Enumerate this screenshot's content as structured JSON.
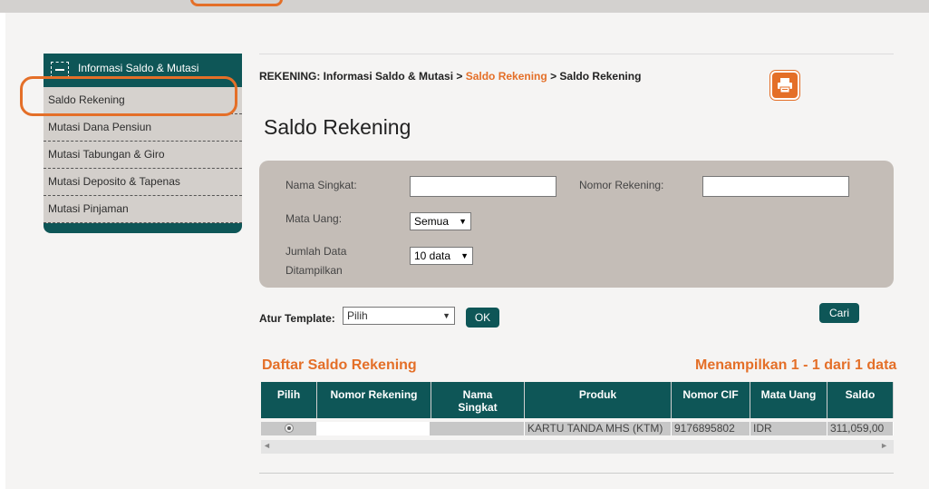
{
  "sidebar": {
    "header": "Informasi Saldo & Mutasi",
    "items": [
      "Saldo Rekening",
      "Mutasi Dana Pensiun",
      "Mutasi Tabungan & Giro",
      "Mutasi Deposito & Tapenas",
      "Mutasi Pinjaman"
    ]
  },
  "breadcrumb": {
    "part1": "REKENING: Informasi Saldo & Mutasi > ",
    "link": "Saldo Rekening",
    "part2": " > Saldo Rekening"
  },
  "page_title": "Saldo Rekening",
  "filter": {
    "nama_singkat_label": "Nama Singkat:",
    "nama_singkat_value": "",
    "nomor_rekening_label": "Nomor Rekening:",
    "nomor_rekening_value": "",
    "mata_uang_label": "Mata Uang:",
    "mata_uang_value": "Semua",
    "jumlah_label_1": "Jumlah Data",
    "jumlah_label_2": "Ditampilkan",
    "jumlah_value": "10 data"
  },
  "template": {
    "label": "Atur Template:",
    "value": "Pilih",
    "ok": "OK"
  },
  "search_button": "Cari",
  "list": {
    "title": "Daftar Saldo Rekening",
    "count": "Menampilkan 1 - 1 dari 1 data",
    "headers": [
      "Pilih",
      "Nomor Rekening",
      "Nama Singkat",
      "Produk",
      "Nomor CIF",
      "Mata Uang",
      "Saldo"
    ],
    "row": {
      "nomor_rekening": "",
      "nama_singkat": "",
      "produk": "KARTU TANDA MHS (KTM)",
      "nomor_cif": "9176895802",
      "mata_uang": "IDR",
      "saldo": "311,059,00"
    }
  },
  "icons": {
    "print": "printer-icon",
    "menu": "collapse-icon"
  },
  "colors": {
    "primary": "#0e5657",
    "accent": "#e46f28",
    "filter_bg": "#c4bdb7"
  }
}
